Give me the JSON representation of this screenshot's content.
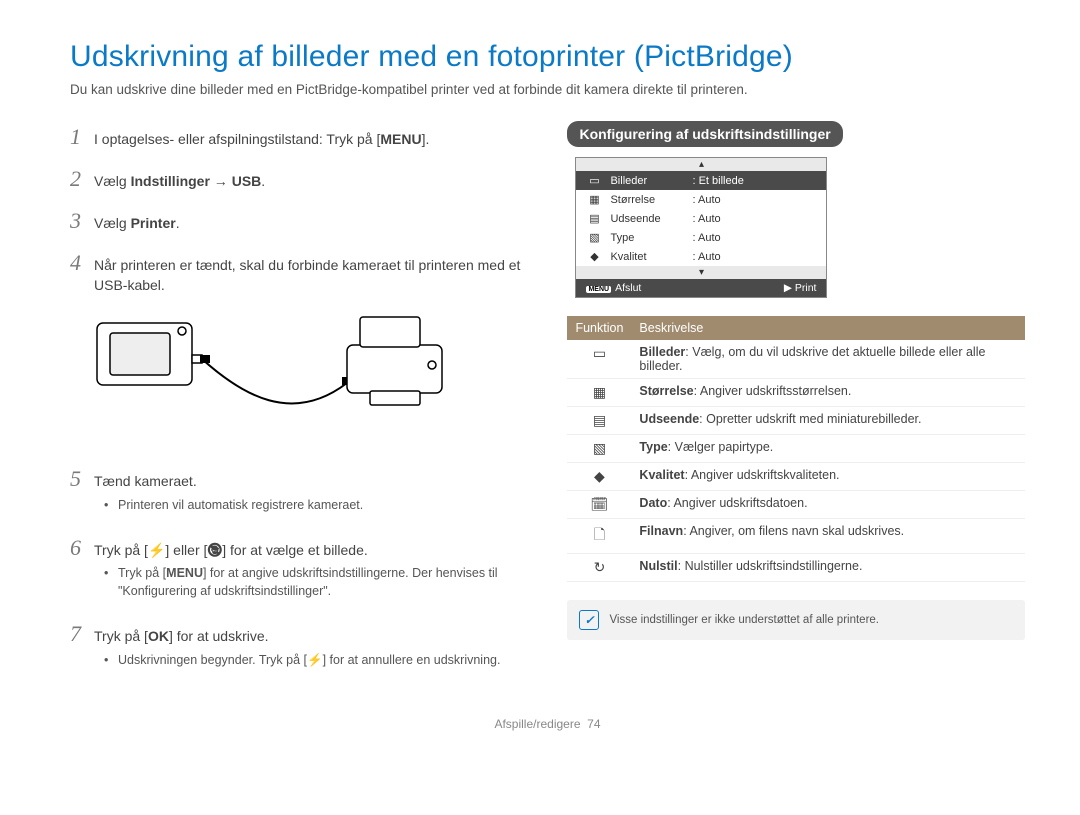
{
  "title": "Udskrivning af billeder med en fotoprinter (PictBridge)",
  "intro": "Du kan udskrive dine billeder med en PictBridge-kompatibel printer ved at forbinde dit kamera direkte til printeren.",
  "steps": {
    "1": {
      "pre": "I optagelses- eller afspilningstilstand: Tryk på [",
      "key": "MENU",
      "post": "]."
    },
    "2": {
      "pre": "Vælg ",
      "b1": "Indstillinger",
      "arrow": " → ",
      "b2": "USB",
      "post": "."
    },
    "3": {
      "pre": "Vælg ",
      "b1": "Printer",
      "post": "."
    },
    "4": "Når printeren er tændt, skal du forbinde kameraet til printeren med et USB-kabel.",
    "5": {
      "text": "Tænd kameraet.",
      "bullet": "Printeren vil automatisk registrere kameraet."
    },
    "6": {
      "pre": "Tryk på [",
      "k1": "⯅",
      "mid": "] eller [",
      "k2": "⏲",
      "post": "] for at vælge et billede.",
      "bullet_pre": "Tryk på [",
      "bullet_key": "MENU",
      "bullet_post": "] for at angive udskriftsindstillingerne. Der henvises til \"Konfigurering af udskriftsindstillinger\"."
    },
    "7": {
      "pre": "Tryk på [",
      "k1": "OK",
      "post": "] for at udskrive.",
      "bullet_pre": "Udskrivningen begynder. Tryk på [",
      "bullet_key": "⯅",
      "bullet_post": "] for at annullere en udskrivning."
    }
  },
  "config_header": "Konfigurering af udskriftsindstillinger",
  "lcd": {
    "top_arrow_up": "▴",
    "rows": [
      {
        "icon": "▭",
        "label": "Billeder",
        "value": "Et billede"
      },
      {
        "icon": "▦",
        "label": "Størrelse",
        "value": "Auto"
      },
      {
        "icon": "▤",
        "label": "Udseende",
        "value": "Auto"
      },
      {
        "icon": "▧",
        "label": "Type",
        "value": "Auto"
      },
      {
        "icon": "◆",
        "label": "Kvalitet",
        "value": "Auto"
      }
    ],
    "bottom_arrow_down": "▾",
    "foot_left_key": "MENU",
    "foot_left": "Afslut",
    "foot_right_key": "▶",
    "foot_right": "Print"
  },
  "func_header": {
    "c1": "Funktion",
    "c2": "Beskrivelse"
  },
  "funcs": [
    {
      "icon": "▭",
      "name": "Billeder",
      "desc": ": Vælg, om du vil udskrive det aktuelle billede eller alle billeder."
    },
    {
      "icon": "▦",
      "name": "Størrelse",
      "desc": ": Angiver udskriftsstørrelsen."
    },
    {
      "icon": "▤",
      "name": "Udseende",
      "desc": ": Opretter udskrift med miniaturebilleder."
    },
    {
      "icon": "▧",
      "name": "Type",
      "desc": ": Vælger papirtype."
    },
    {
      "icon": "◆",
      "name": "Kvalitet",
      "desc": ": Angiver udskriftskvaliteten."
    },
    {
      "icon": "🗓",
      "name": "Dato",
      "desc": ": Angiver udskriftsdatoen."
    },
    {
      "icon": "🗋",
      "name": "Filnavn",
      "desc": ": Angiver, om filens navn skal udskrives."
    },
    {
      "icon": "↻",
      "name": "Nulstil",
      "desc": ": Nulstiller udskriftsindstillingerne."
    }
  ],
  "note": "Visse indstillinger er ikke understøttet af alle printere.",
  "footer": {
    "section": "Afspille/redigere",
    "page": "74"
  }
}
